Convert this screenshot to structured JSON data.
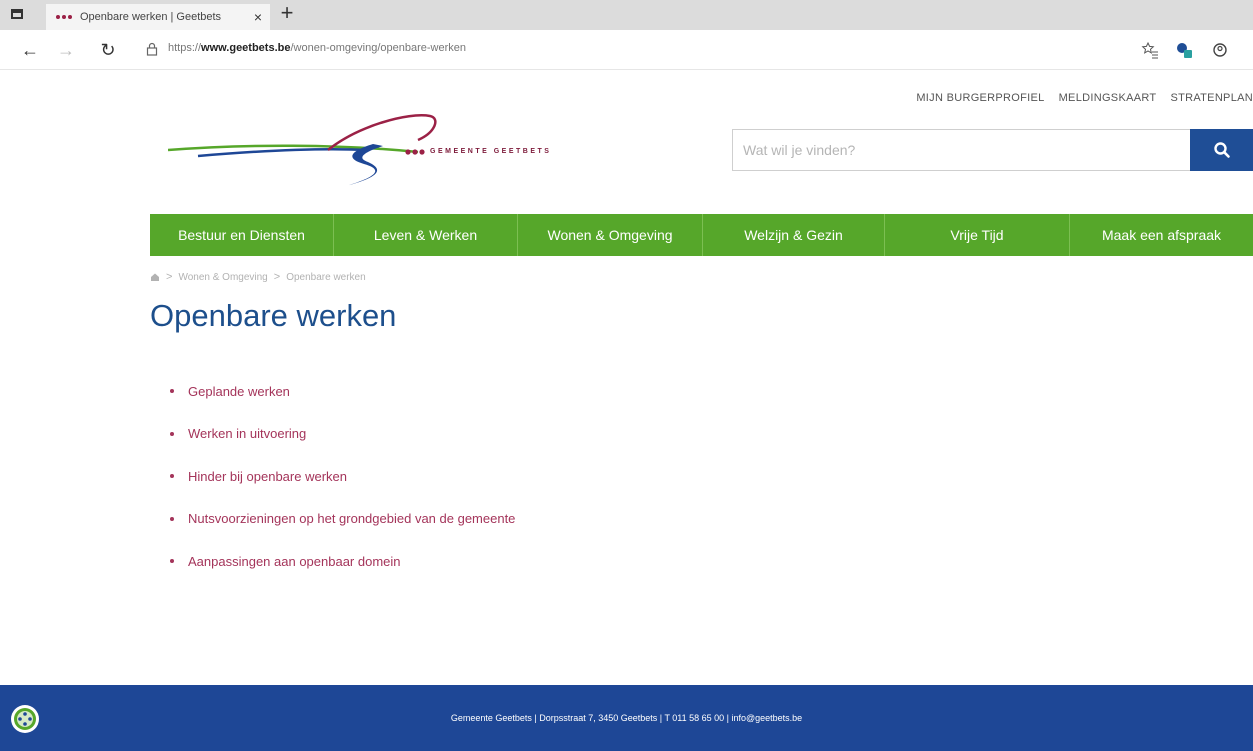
{
  "browser": {
    "tab_title": "Openbare werken | Geetbets",
    "tab_close": "×",
    "new_tab": "+",
    "url_prefix": "https://",
    "url_host": "www.geetbets.be",
    "url_path": "/wonen-omgeving/openbare-werken",
    "back": "←",
    "forward": "→",
    "reload": "↻"
  },
  "header": {
    "toplinks": [
      "MIJN BURGERPROFIEL",
      "MELDINGSKAART",
      "STRATENPLAN"
    ],
    "logo_text": "GEMEENTE GEETBETS",
    "search_placeholder": "Wat wil je vinden?"
  },
  "mainnav": {
    "items": [
      "Bestuur en Diensten",
      "Leven & Werken",
      "Wonen & Omgeving",
      "Welzijn & Gezin",
      "Vrije Tijd",
      "Maak een afspraak"
    ]
  },
  "breadcrumb": {
    "sep": ">",
    "items": [
      "Wonen & Omgeving",
      "Openbare werken"
    ]
  },
  "page": {
    "title": "Openbare werken",
    "links": [
      "Geplande werken",
      "Werken in uitvoering",
      "Hinder bij openbare werken",
      "Nutsvoorzieningen op het grondgebied van de gemeente",
      "Aanpassingen aan openbaar domein"
    ]
  },
  "footer": {
    "text": "Gemeente Geetbets  |  Dorpsstraat 7, 3450 Geetbets  |  T 011 58 65 00  |  info@geetbets.be"
  },
  "colors": {
    "nav_green": "#56a72a",
    "brand_blue": "#1f4e96",
    "link_red": "#a4345a",
    "title_blue": "#1d4f8c"
  }
}
